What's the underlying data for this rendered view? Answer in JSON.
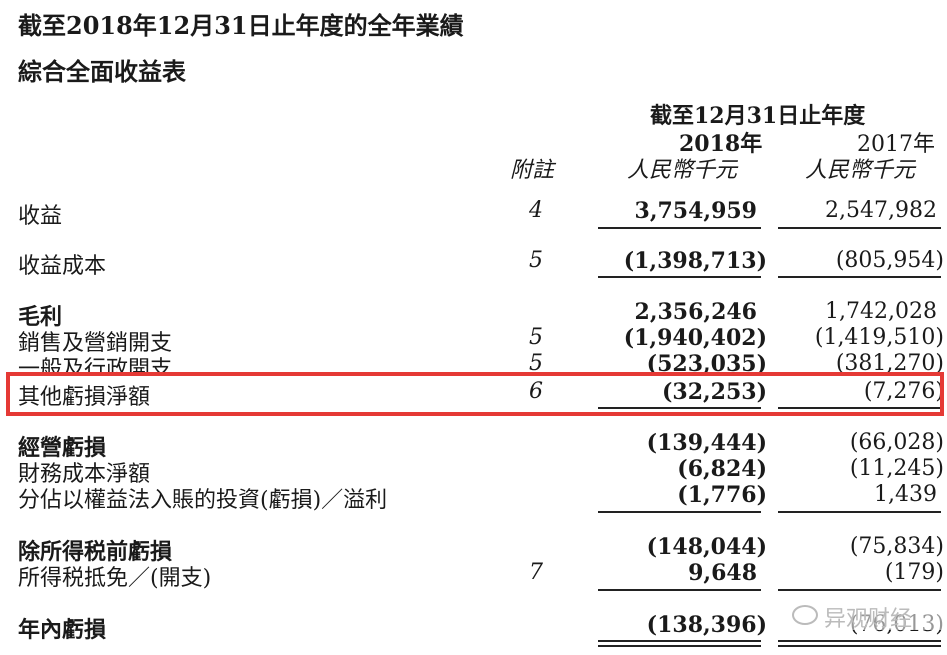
{
  "titles": {
    "main": "截至2018年12月31日止年度的全年業績",
    "sub": "綜合全面收益表"
  },
  "header": {
    "period": "截至12月31日止年度",
    "year_2018": "2018年",
    "year_2017": "2017年",
    "note": "附註",
    "unit_2018": "人民幣千元",
    "unit_2017": "人民幣千元"
  },
  "rows": [
    {
      "label": "收益",
      "note": "4",
      "v2018": "3,754,959",
      "v2017": "2,547,982"
    },
    {
      "label": "收益成本",
      "note": "5",
      "v2018": "(1,398,713)",
      "v2017": "(805,954)"
    },
    {
      "label": "毛利",
      "note": "",
      "v2018": "2,356,246",
      "v2017": "1,742,028"
    },
    {
      "label": "銷售及營銷開支",
      "note": "5",
      "v2018": "(1,940,402)",
      "v2017": "(1,419,510)"
    },
    {
      "label": "一般及行政開支",
      "note": "5",
      "v2018": "(523,035)",
      "v2017": "(381,270)"
    },
    {
      "label": "其他虧損淨額",
      "note": "6",
      "v2018": "(32,253)",
      "v2017": "(7,276)"
    },
    {
      "label": "經營虧損",
      "note": "",
      "v2018": "(139,444)",
      "v2017": "(66,028)"
    },
    {
      "label": "財務成本淨額",
      "note": "",
      "v2018": "(6,824)",
      "v2017": "(11,245)"
    },
    {
      "label": "分佔以權益法入賬的投資(虧損)／溢利",
      "note": "",
      "v2018": "(1,776)",
      "v2017": "1,439"
    },
    {
      "label": "除所得税前虧損",
      "note": "",
      "v2018": "(148,044)",
      "v2017": "(75,834)"
    },
    {
      "label": "所得税抵免／(開支)",
      "note": "7",
      "v2018": "9,648",
      "v2017": "(179)"
    },
    {
      "label": "年內虧損",
      "note": "",
      "v2018": "(138,396)",
      "v2017": "(76,013)"
    }
  ],
  "watermark": "异观财经",
  "colors": {
    "highlight": "#e53935",
    "text": "#1a1a1a"
  }
}
